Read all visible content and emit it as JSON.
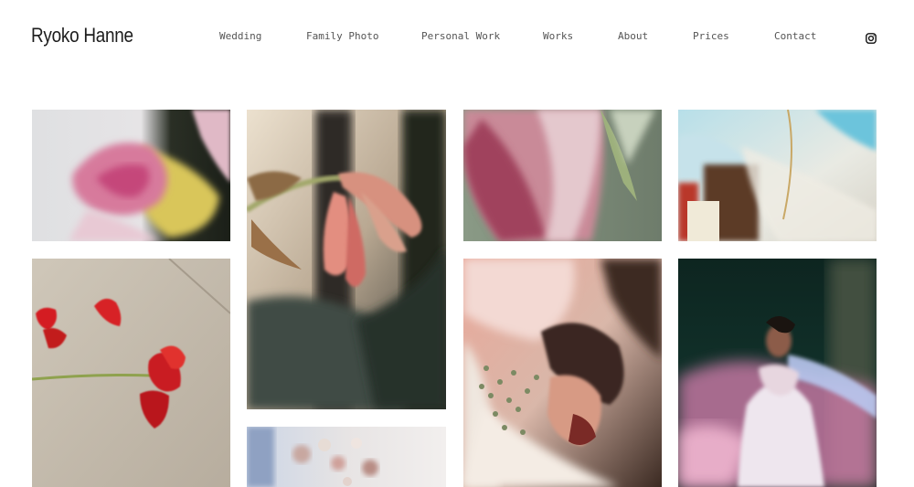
{
  "site": {
    "title": "Ryoko Hanne"
  },
  "nav": {
    "items": [
      {
        "label": "Wedding"
      },
      {
        "label": "Family Photo"
      },
      {
        "label": "Personal Work"
      },
      {
        "label": "Works"
      },
      {
        "label": "About"
      },
      {
        "label": "Prices"
      },
      {
        "label": "Contact"
      }
    ],
    "social_icon": "instagram-icon"
  },
  "gallery": {
    "photos": [
      {
        "subject": "pink-tulip-petals"
      },
      {
        "subject": "drooping-amaryllis"
      },
      {
        "subject": "pink-tulip-closeup"
      },
      {
        "subject": "plastic-wrap-still-life"
      },
      {
        "subject": "red-flower-on-pavement"
      },
      {
        "subject": "bride-with-flowers"
      },
      {
        "subject": "bride-in-light-leak"
      },
      {
        "subject": "pearl-decoration"
      }
    ]
  }
}
